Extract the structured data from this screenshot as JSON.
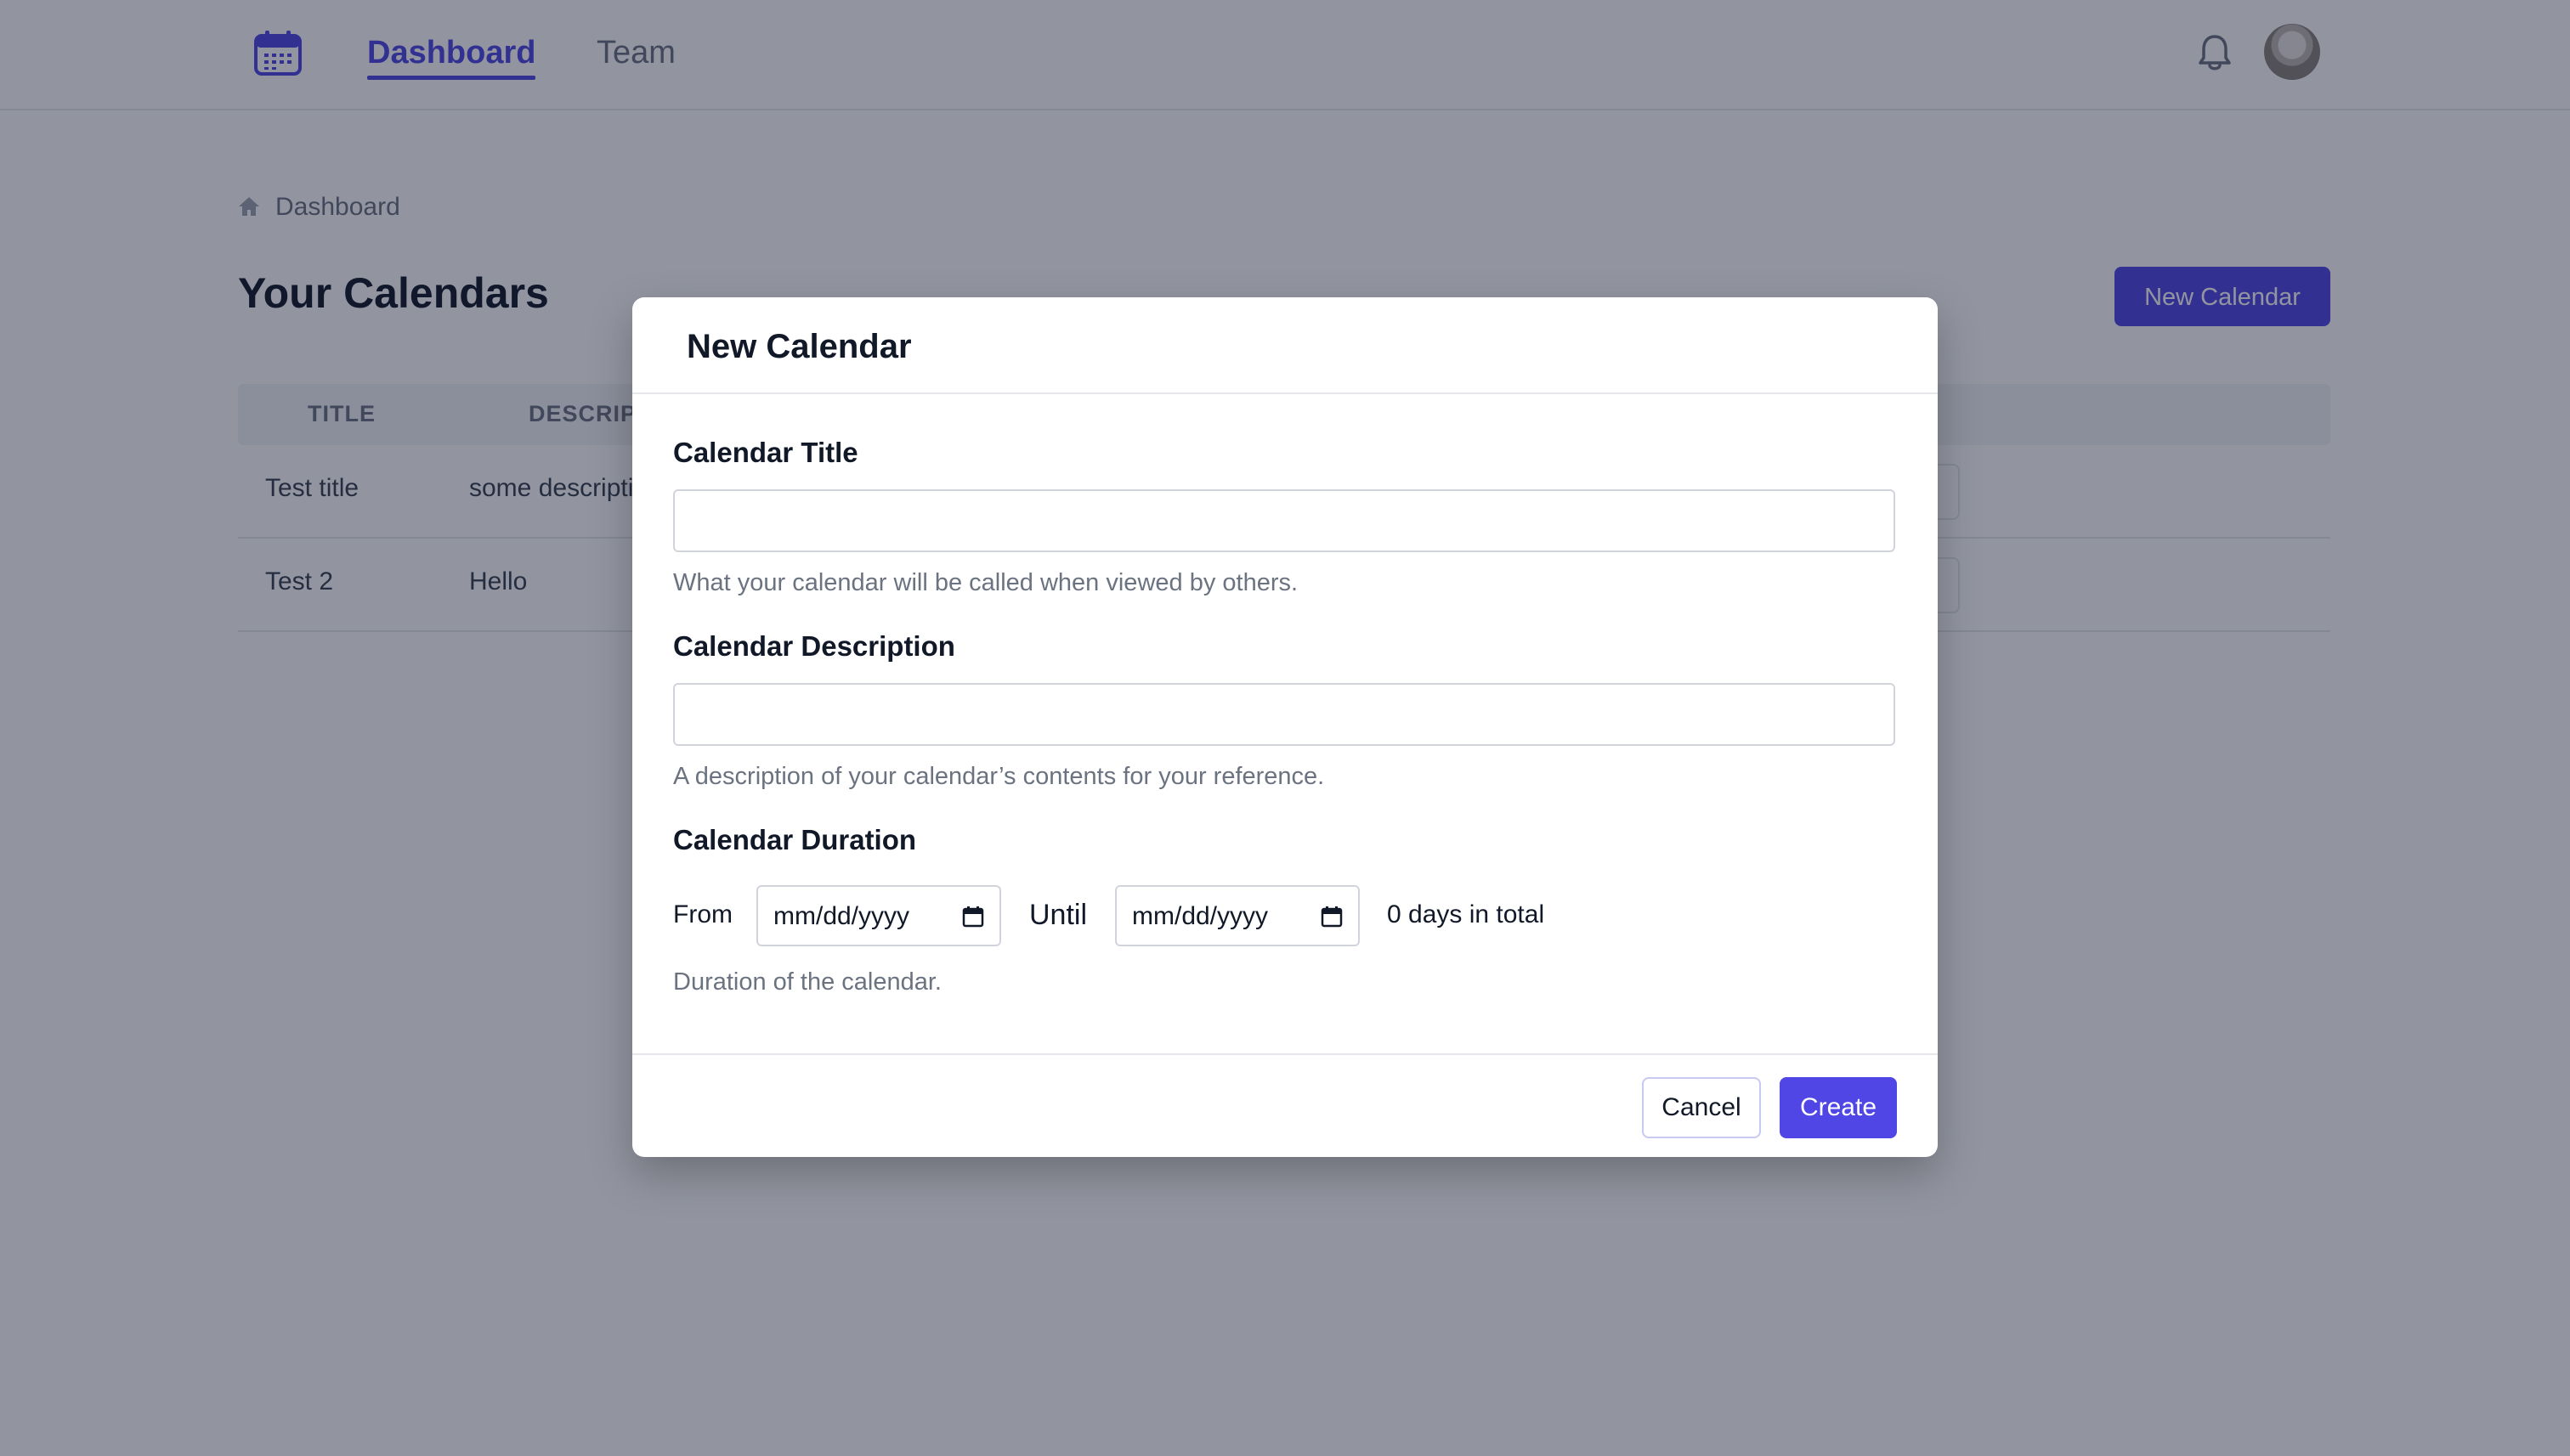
{
  "nav": {
    "links": [
      {
        "label": "Dashboard",
        "active": true
      },
      {
        "label": "Team",
        "active": false
      }
    ],
    "accent_color": "#4f46e5"
  },
  "breadcrumb": {
    "label": "Dashboard"
  },
  "page": {
    "title": "Your Calendars",
    "new_calendar_label": "New Calendar"
  },
  "table": {
    "headers": [
      "TITLE",
      "DESCRIP"
    ],
    "rows": [
      {
        "title": "Test title",
        "description": "some descripti"
      },
      {
        "title": "Test 2",
        "description": "Hello"
      }
    ]
  },
  "modal": {
    "title": "New Calendar",
    "calendar_title": {
      "label": "Calendar Title",
      "value": "",
      "help": "What your calendar will be called when viewed by others."
    },
    "calendar_description": {
      "label": "Calendar Description",
      "value": "",
      "help": "A description of your calendar’s contents for your reference."
    },
    "calendar_duration": {
      "label": "Calendar Duration",
      "from_label": "From",
      "from_value": "mm/dd/yyyy",
      "until_label": "Until",
      "until_value": "mm/dd/yyyy",
      "total": "0 days in total",
      "help": "Duration of the calendar."
    },
    "cancel_label": "Cancel",
    "create_label": "Create"
  }
}
